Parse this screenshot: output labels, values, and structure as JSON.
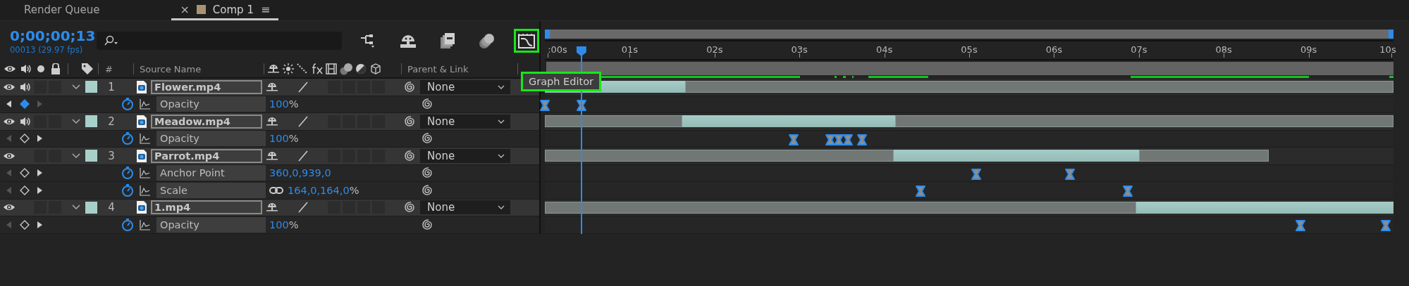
{
  "tabs": [
    {
      "label": "Render Queue",
      "selected": false
    },
    {
      "label": "Comp 1",
      "selected": true,
      "close": "×",
      "menu": "≡",
      "color": "#a89373"
    }
  ],
  "timecode": "0;00;00;13",
  "frame_info": "00013 (29.97 fps)",
  "toolbar": [
    {
      "kind": "flowchart",
      "highlighted": false
    },
    {
      "kind": "shy",
      "highlighted": false
    },
    {
      "kind": "frame_blending",
      "highlighted": false
    },
    {
      "kind": "motion_blur",
      "highlighted": false
    },
    {
      "kind": "graph_editor",
      "highlighted": true
    }
  ],
  "tooltip": {
    "text": "Graph Editor",
    "highlighted": true
  },
  "columns": {
    "number": "#",
    "source_name": "Source Name",
    "parent": "Parent & Link"
  },
  "ruler": [
    ":00s",
    "01s",
    "02s",
    "03s",
    "04s",
    "05s",
    "06s",
    "07s",
    "08s",
    "09s",
    "10s"
  ],
  "playhead": {
    "level": 0.043
  },
  "layers": [
    {
      "number": "1",
      "name": "Flower.mp4",
      "visible": true,
      "audio": true,
      "solo": false,
      "locked": false,
      "expanded": true,
      "parent": "None",
      "properties": [
        {
          "name": "Opacity",
          "value": "100",
          "unit": "%",
          "at_keyframe": true,
          "prev_enabled": true,
          "next_enabled": false,
          "keyframes": [
            {
              "level": 0.0
            },
            {
              "level": 0.043
            }
          ]
        }
      ]
    },
    {
      "number": "2",
      "name": "Meadow.mp4",
      "visible": true,
      "audio": true,
      "solo": false,
      "locked": false,
      "expanded": true,
      "parent": "None",
      "properties": [
        {
          "name": "Opacity",
          "value": "100",
          "unit": "%",
          "at_keyframe": false,
          "prev_enabled": false,
          "next_enabled": true,
          "keyframes": [
            {
              "level": 0.293
            },
            {
              "level": 0.336
            },
            {
              "level": 0.346
            },
            {
              "level": 0.357
            },
            {
              "level": 0.374
            }
          ]
        }
      ]
    },
    {
      "number": "3",
      "name": "Parrot.mp4",
      "visible": true,
      "audio": false,
      "solo": false,
      "locked": false,
      "expanded": true,
      "parent": "None",
      "properties": [
        {
          "name": "Anchor Point",
          "value": "360,0,939,0",
          "at_keyframe": false,
          "prev_enabled": false,
          "next_enabled": true,
          "keyframes": [
            {
              "level": 0.508
            },
            {
              "level": 0.619
            }
          ]
        },
        {
          "name": "Scale",
          "value": "164,0,164,0",
          "unit": "%",
          "linked": true,
          "at_keyframe": false,
          "prev_enabled": false,
          "next_enabled": true,
          "keyframes": [
            {
              "level": 0.443
            },
            {
              "level": 0.687
            }
          ]
        }
      ]
    },
    {
      "number": "4",
      "name": "1.mp4",
      "visible": true,
      "audio": false,
      "solo": false,
      "locked": false,
      "expanded": true,
      "parent": "None",
      "properties": [
        {
          "name": "Opacity",
          "value": "100",
          "unit": "%",
          "at_keyframe": false,
          "prev_enabled": false,
          "next_enabled": true,
          "keyframes": [
            {
              "level": 0.89
            },
            {
              "level": 0.991
            }
          ]
        }
      ]
    }
  ]
}
